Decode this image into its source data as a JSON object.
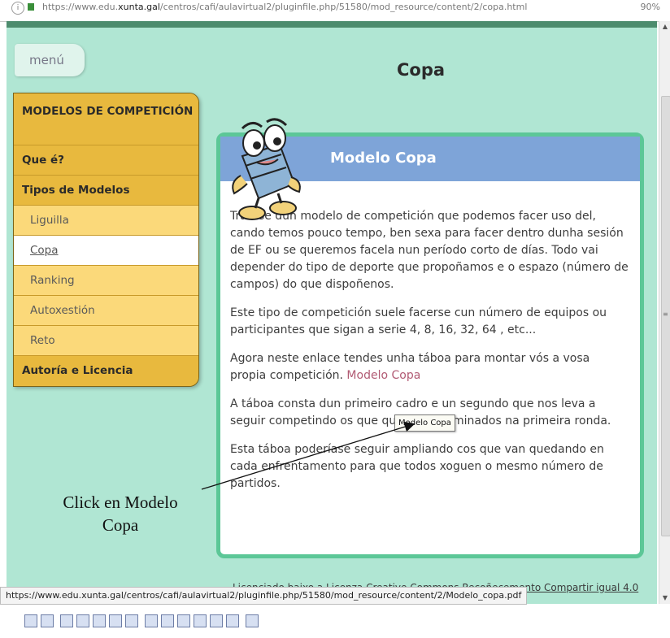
{
  "browser": {
    "url_prefix": "https://www.edu.",
    "url_domain": "xunta.gal",
    "url_rest": "/centros/cafi/aulavirtual2/pluginfile.php/51580/mod_resource/content/2/copa.html",
    "zoom": "90%"
  },
  "menu": {
    "label": "menú"
  },
  "page": {
    "title": "Copa"
  },
  "sidebar": {
    "items": [
      {
        "label": "MODELOS DE COMPETICIÓN"
      },
      {
        "label": "Que é?"
      },
      {
        "label": "Tipos de Modelos"
      },
      {
        "label": "Liguilla"
      },
      {
        "label": "Copa"
      },
      {
        "label": "Ranking"
      },
      {
        "label": "Autoxestión"
      },
      {
        "label": "Reto"
      },
      {
        "label": "Autoría e Licencia"
      }
    ]
  },
  "content": {
    "title": "Modelo Copa",
    "p1": "Trátase dun modelo de competición que podemos facer uso del, cando temos pouco tempo, ben sexa para facer dentro dunha sesión de EF ou se queremos facela nun período corto de días. Todo vai depender do tipo de deporte que propoñamos e o espazo (número de campos) do que dispoñenos.",
    "p2": "Este tipo de competición suele facerse cun número de equipos ou participantes  que sigan a serie  4, 8, 16, 32, 64 , etc...",
    "p3_text": "Agora neste enlace tendes unha táboa para montar vós a vosa propia competición. ",
    "p3_link": "Modelo Copa",
    "p4": "A táboa consta dun primeiro cadro e un segundo que nos leva a seguir competindo os que quedaron eliminados na primeira ronda.",
    "p5": "Esta táboa poderíase seguir ampliando cos que van quedando en cada enfrentamento para que todos xoguen o mesmo número de partidos."
  },
  "tooltip": {
    "text": "Modelo Copa"
  },
  "annotation": {
    "line1": "Click en Modelo",
    "line2": "Copa"
  },
  "footer": {
    "license_text": "Licenciado baixo a ",
    "license_link": "Licenza Creative Commons Recoñecemento Compartir igual 4.0"
  },
  "statusbar": {
    "url": "https://www.edu.xunta.gal/centros/cafi/aulavirtual2/pluginfile.php/51580/mod_resource/content/2/Modelo_copa.pdf"
  },
  "colors": {
    "page_bg": "#b0e6d3",
    "sidebar_bg": "#f2c851",
    "box_border": "#5cc797",
    "box_header": "#7ea4d8",
    "link": "#b15a73"
  }
}
